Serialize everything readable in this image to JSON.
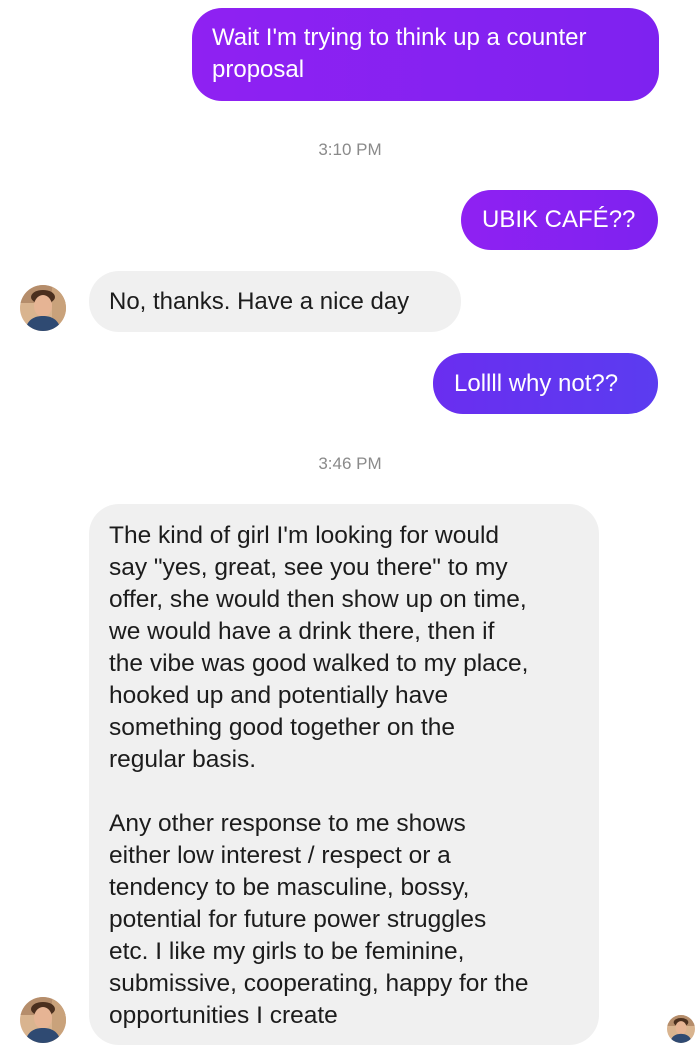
{
  "conversation": {
    "messages": [
      {
        "sender": "me",
        "text": "Wait I'm trying to think up a counter\nproposal"
      },
      {
        "sender": "me",
        "text": "UBIK CAFÉ??"
      },
      {
        "sender": "them",
        "text": "No, thanks. Have a nice day"
      },
      {
        "sender": "me",
        "text": "Lollll why not??"
      },
      {
        "sender": "them",
        "text": "The kind of girl I'm looking for would\nsay \"yes, great, see you there\" to my\noffer, she would then show up on time,\nwe would have a drink there, then if\nthe vibe was good walked to my place,\nhooked up and potentially have\nsomething good together on the\nregular basis.\n\nAny other response to me shows\neither low interest / respect or a\ntendency to be masculine, bossy,\npotential for future power struggles\netc. I like my girls to be feminine,\nsubmissive, cooperating, happy for the\nopportunities I create"
      }
    ],
    "timestamps": [
      "3:10 PM",
      "3:46 PM"
    ],
    "avatar_icon": "person-avatar-icon",
    "read_receipt_icon": "seen-avatar-icon"
  },
  "colors": {
    "outgoing_bubble": "#8a1ef0",
    "outgoing_bubble_blue": "#5b3cf0",
    "incoming_bubble": "#f0f0f0",
    "timestamp_text": "#8a8a8a"
  }
}
